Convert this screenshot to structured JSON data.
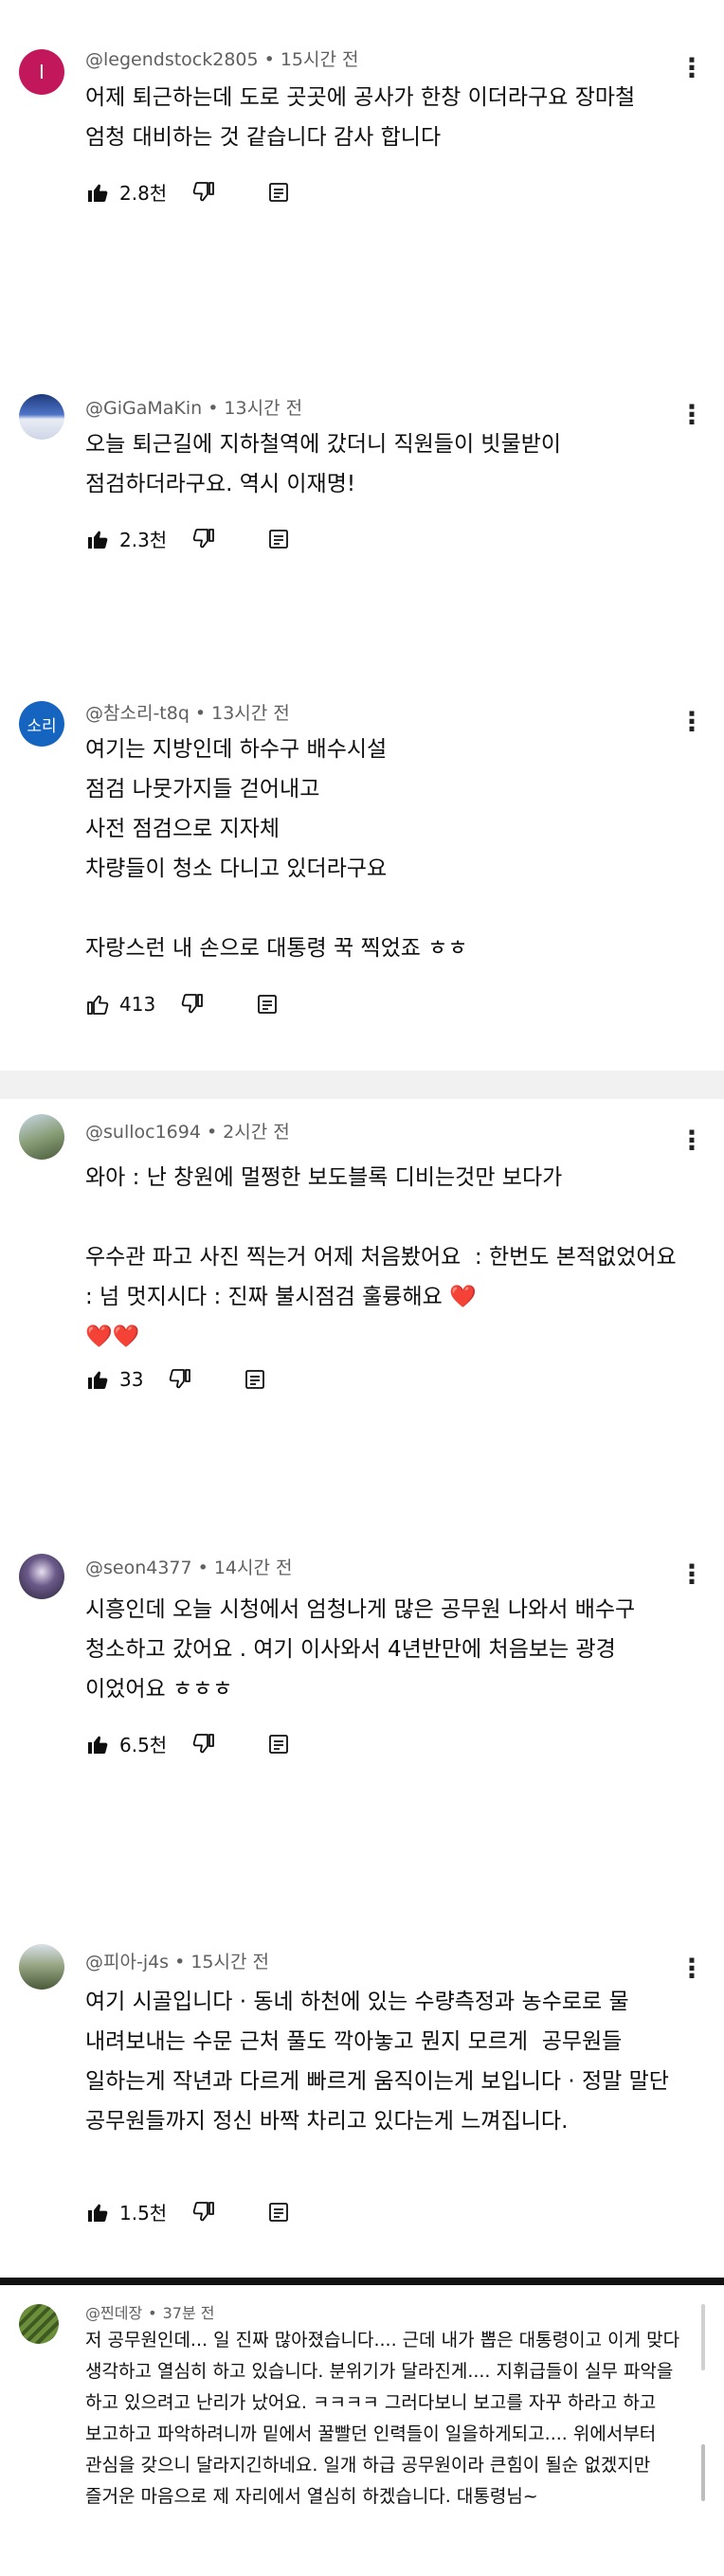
{
  "comments": [
    {
      "handle": "@legendstock2805",
      "time": "15시간 전",
      "avatar_letter": "I",
      "avatar_color": "#c2185b",
      "text": "어제 퇴근하는데 도로 곳곳에 공사가 한창 이더라구요 장마철  엄청 대비하는 것 같습니다 감사 합니다",
      "likes": "2.8천",
      "liked": true
    },
    {
      "handle": "@GiGaMaKin",
      "time": "13시간 전",
      "avatar_letter": "",
      "avatar_color": "#3b5ba5",
      "text": "오늘 퇴근길에 지하철역에 갔더니 직원들이 빗물받이 점검하더라구요. 역시 이재명!",
      "likes": "2.3천",
      "liked": true
    },
    {
      "handle": "@참소리-t8q",
      "time": "13시간 전",
      "avatar_letter": "소리",
      "avatar_color": "#1565c0",
      "text": "여기는 지방인데 하수구 배수시설\n점검 나뭇가지들 걷어내고\n사전 점검으로 지자체\n차량들이 청소 다니고 있더라구요\n\n자랑스런 내 손으로 대통령 꾹 찍었죠 ㅎㅎ",
      "likes": "413",
      "liked": false
    },
    {
      "handle": "@sulloc1694",
      "time": "2시간 전",
      "avatar_letter": "",
      "avatar_color": "#7a8a5a",
      "text": "와아 : 난 창원에 멀쩡한 보도블록 디비는것만 보다가\n\n우수관 파고 사진 찍는거 어제 처음봤어요  : 한번도 본적없었어요 : 넘 멋지시다 : 진짜 불시점검 훌륭해요 ❤️\n❤️❤️",
      "likes": "33",
      "liked": true
    },
    {
      "handle": "@seon4377",
      "time": "14시간 전",
      "avatar_letter": "",
      "avatar_color": "#4a3f6b",
      "text": "시흥인데 오늘 시청에서 엄청나게 많은 공무원 나와서 배수구 청소하고 갔어요 . 여기 이사와서 4년반만에 처음보는 광경 이었어요 ㅎㅎㅎ",
      "likes": "6.5천",
      "liked": true
    },
    {
      "handle": "@피아-j4s",
      "time": "15시간 전",
      "avatar_letter": "",
      "avatar_color": "#5d6b4e",
      "text": "여기 시골입니다 · 동네 하천에 있는 수량측정과 농수로로 물 내려보내는 수문 근처 풀도 깍아놓고 뭔지 모르게  공무원들 일하는게 작년과 다르게 빠르게 움직이는게 보입니다 · 정말 말단 공무원들까지 정신 바짝 차리고 있다는게 느껴집니다.",
      "likes": "1.5천",
      "liked": true
    },
    {
      "handle": "@찐데장",
      "time": "37분 전",
      "avatar_letter": "",
      "avatar_color": "#6b8e3a",
      "text": "저 공무원인데... 일 진짜 많아졌습니다.... 근데 내가 뽑은 대통령이고 이게 맞다 생각하고 열심히 하고 있습니다. 분위기가 달라진게.... 지휘급들이 실무 파악을 하고 있으려고 난리가 났어요. ㅋㅋㅋㅋ 그러다보니 보고를 자꾸 하라고 하고 보고하고 파악하려니까 밑에서 꿀빨던 인력들이 일을하게되고.... 위에서부터 관심을 갖으니 달라지긴하네요. 일개 하급 공무원이라 큰힘이 될순 없겠지만 즐거운 마음으로 제 자리에서 열심히 하겠습니다. 대통령님~"
    }
  ],
  "ui": {
    "separator": "•",
    "more_glyph": "⋮"
  }
}
